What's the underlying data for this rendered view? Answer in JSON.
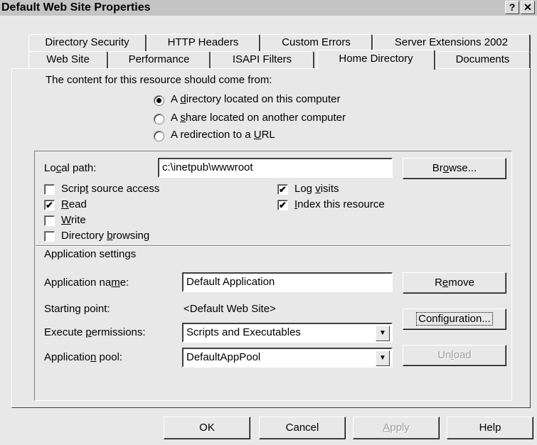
{
  "window": {
    "title": "Default Web Site Properties",
    "help_glyph": "?",
    "close_glyph": "✕"
  },
  "tabs_row1": [
    "Directory Security",
    "HTTP Headers",
    "Custom Errors",
    "Server Extensions 2002"
  ],
  "tabs_row2": [
    "Web Site",
    "Performance",
    "ISAPI Filters",
    "Home Directory",
    "Documents"
  ],
  "active_tab": "Home Directory",
  "content_source": {
    "heading": "The content for this resource should come from:",
    "options": [
      {
        "pre": "A ",
        "key": "d",
        "post": "irectory located on this computer",
        "selected": true
      },
      {
        "pre": "A ",
        "key": "s",
        "post": "hare located on another computer",
        "selected": false
      },
      {
        "pre": "A redirection to a ",
        "key": "U",
        "post": "RL",
        "selected": false
      }
    ]
  },
  "local_path": {
    "label_pre": "Lo",
    "label_key": "c",
    "label_post": "al path:",
    "value": "c:\\inetpub\\wwwroot",
    "browse_pre": "Br",
    "browse_key": "o",
    "browse_post": "wse..."
  },
  "permissions": {
    "script_source": {
      "pre": "Scrip",
      "key": "t",
      "post": " source access",
      "checked": false
    },
    "read": {
      "pre": "",
      "key": "R",
      "post": "ead",
      "checked": true
    },
    "write": {
      "pre": "",
      "key": "W",
      "post": "rite",
      "checked": false
    },
    "dir_browsing": {
      "pre": "Directory ",
      "key": "b",
      "post": "rowsing",
      "checked": false
    },
    "log_visits": {
      "pre": "Log ",
      "key": "v",
      "post": "isits",
      "checked": true
    },
    "index_resource": {
      "pre": "",
      "key": "I",
      "post": "ndex this resource",
      "checked": true
    },
    "check_glyph": "✔"
  },
  "app_settings": {
    "heading": "Application settings",
    "name_label_pre": "Application na",
    "name_label_key": "m",
    "name_label_post": "e:",
    "name_value": "Default Application",
    "remove_pre": "R",
    "remove_key": "e",
    "remove_post": "move",
    "starting_point_label": "Starting point:",
    "starting_point_value": "<Default Web Site>",
    "configuration_label": "Configuration...",
    "exec_label_pre": "Execute ",
    "exec_label_key": "p",
    "exec_label_post": "ermissions:",
    "exec_value": "Scripts and Executables",
    "pool_label_pre": "Applicatio",
    "pool_label_key": "n",
    "pool_label_post": " pool:",
    "pool_value": "DefaultAppPool",
    "unload_pre": "Un",
    "unload_key": "l",
    "unload_post": "oad",
    "dropdown_glyph": "▼"
  },
  "footer": {
    "ok": "OK",
    "cancel": "Cancel",
    "apply_key": "A",
    "apply_post": "pply",
    "help": "Help"
  }
}
